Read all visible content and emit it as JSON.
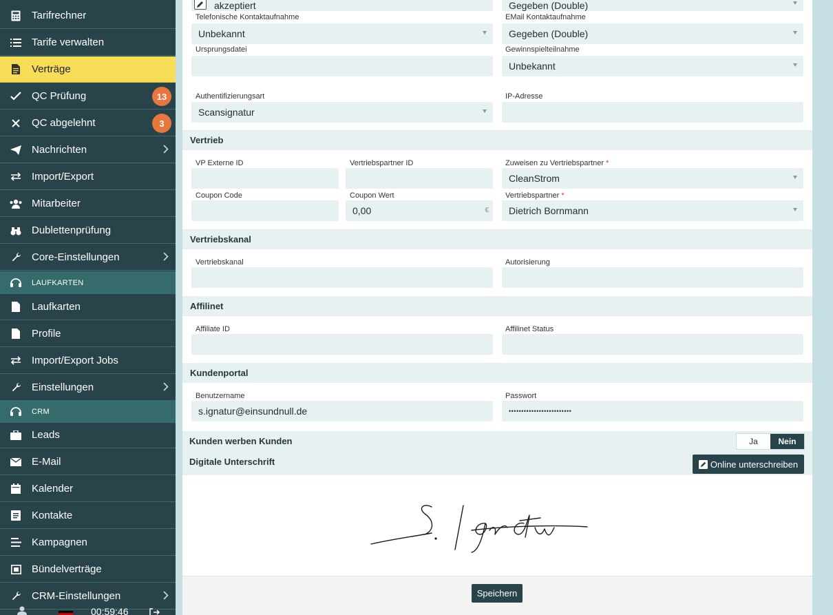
{
  "sidebar": {
    "items": [
      {
        "label": "Tarifrechner",
        "icon": "calculator-icon"
      },
      {
        "label": "Tarife verwalten",
        "icon": "list-icon"
      },
      {
        "label": "Verträge",
        "icon": "document-icon",
        "active": true
      },
      {
        "label": "QC Prüfung",
        "icon": "check-icon",
        "badge": "13"
      },
      {
        "label": "QC abgelehnt",
        "icon": "x-icon",
        "badge": "3"
      },
      {
        "label": "Nachrichten",
        "icon": "send-icon",
        "chevron": true
      },
      {
        "label": "Import/Export",
        "icon": "arrows-exchange-icon"
      },
      {
        "label": "Mitarbeiter",
        "icon": "users-icon"
      },
      {
        "label": "Dublettenprüfung",
        "icon": "binoculars-icon"
      },
      {
        "label": "Core-Einstellungen",
        "icon": "wrench-icon",
        "chevron": true
      }
    ],
    "section_laufkarten": "LAUFKARTEN",
    "laufkarten_items": [
      {
        "label": "Laufkarten",
        "icon": "file-icon"
      },
      {
        "label": "Profile",
        "icon": "file-icon"
      },
      {
        "label": "Import/Export Jobs",
        "icon": "arrows-exchange-icon"
      },
      {
        "label": "Einstellungen",
        "icon": "wrench-icon",
        "chevron": true
      }
    ],
    "section_crm": "CRM",
    "crm_items": [
      {
        "label": "Leads",
        "icon": "briefcase-icon"
      },
      {
        "label": "E-Mail",
        "icon": "envelope-icon"
      },
      {
        "label": "Kalender",
        "icon": "calendar-icon"
      },
      {
        "label": "Kontakte",
        "icon": "contacts-icon"
      },
      {
        "label": "Kampagnen",
        "icon": "align-icon"
      },
      {
        "label": "Bündelverträge",
        "icon": "bundle-icon"
      },
      {
        "label": "CRM-Einstellungen",
        "icon": "wrench-icon",
        "chevron": true
      }
    ],
    "footer": {
      "timer": "00:59:46"
    }
  },
  "form": {
    "top": {
      "consent_value": "akzeptiert",
      "consent_right_value": "Gegeben (Double)"
    },
    "telefon_label": "Telefonische Kontaktaufnahme",
    "telefon_value": "Unbekannt",
    "email_label": "EMail Kontaktaufnahme",
    "email_value": "Gegeben (Double)",
    "ursprung_label": "Ursprungsdatei",
    "ursprung_value": "",
    "gewinnspiel_label": "Gewinnspielteilnahme",
    "gewinnspiel_value": "Unbekannt",
    "auth_label": "Authentifizierungsart",
    "auth_value": "Scansignatur",
    "ip_label": "IP-Adresse",
    "ip_value": "",
    "vertrieb": {
      "title": "Vertrieb",
      "vp_externe_label": "VP Externe ID",
      "vp_externe_value": "",
      "vp_id_label": "Vertriebspartner ID",
      "vp_id_value": "",
      "zuweisen_label": "Zuweisen zu Vertriebspartner",
      "zuweisen_value": "CleanStrom",
      "coupon_code_label": "Coupon Code",
      "coupon_code_value": "",
      "coupon_wert_label": "Coupon Wert",
      "coupon_wert_value": "0,00",
      "currency": "€",
      "partner_label": "Vertriebspartner",
      "partner_value": "Dietrich Bornmann",
      "required_mark": "*"
    },
    "vertriebskanal": {
      "title": "Vertriebskanal",
      "kanal_label": "Vertriebskanal",
      "kanal_value": "",
      "autorisierung_label": "Autorisierung",
      "autorisierung_value": ""
    },
    "affilinet": {
      "title": "Affilinet",
      "id_label": "Affiliate ID",
      "id_value": "",
      "status_label": "Affilinet Status",
      "status_value": ""
    },
    "kundenportal": {
      "title": "Kundenportal",
      "user_label": "Benutzername",
      "user_value": "s.ignatur@einsundnull.de",
      "pass_label": "Passwort",
      "pass_value": "•••••••••••••••••••••••••"
    },
    "kwk": {
      "title": "Kunden werben Kunden",
      "yes": "Ja",
      "no": "Nein",
      "selected": "Nein"
    },
    "signature": {
      "title": "Digitale Unterschrift",
      "button": "Online unterschreiben"
    },
    "save_button": "Speichern"
  },
  "colors": {
    "sidebar_bg": "#28434a",
    "active_bg": "#f7dc56",
    "badge": "#e8773d",
    "field_bg": "#e8f1f2"
  }
}
